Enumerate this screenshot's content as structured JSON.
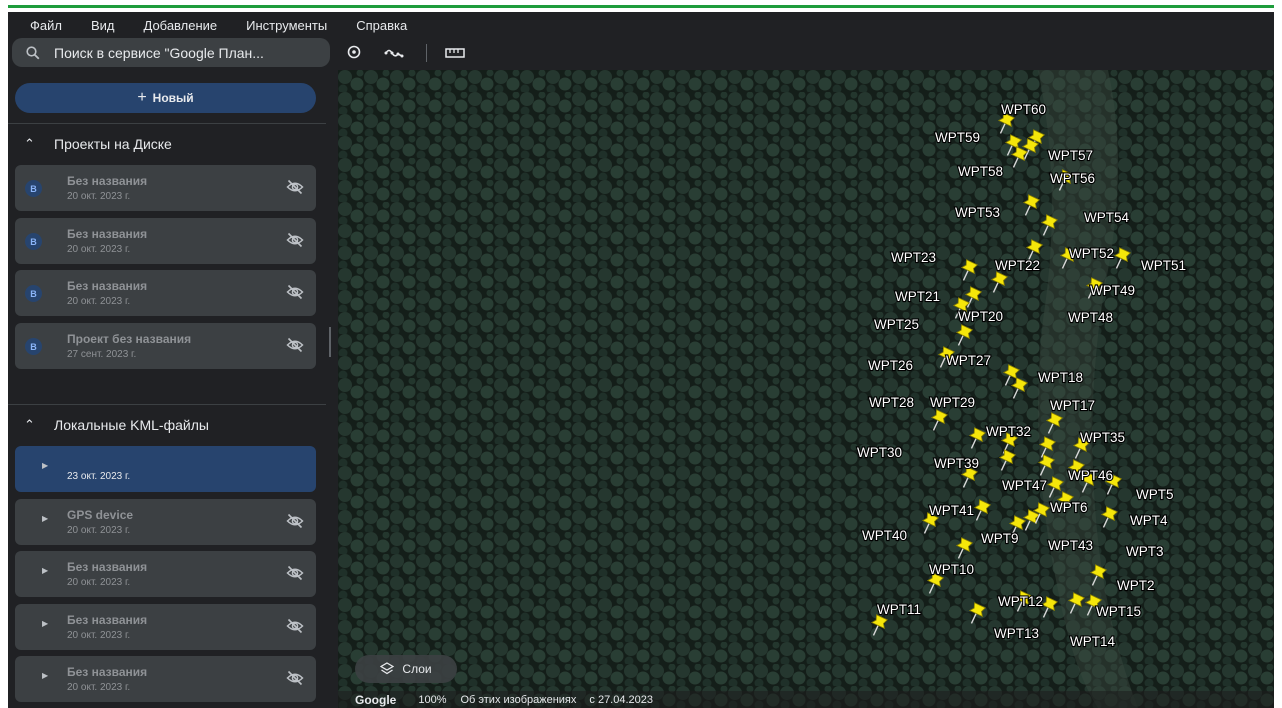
{
  "menu": [
    "Файл",
    "Вид",
    "Добавление",
    "Инструменты",
    "Справка"
  ],
  "search": {
    "placeholder": "Поиск в сервисе \"Google План..."
  },
  "toolbar_icons": [
    "place-pin-icon",
    "path-icon",
    "ruler-icon"
  ],
  "sidebar": {
    "new_button": "Новый",
    "drive_section": {
      "title": "Проекты на Диске",
      "items": [
        {
          "badge": "B",
          "title": "Без названия",
          "date": "20 окт. 2023 г."
        },
        {
          "badge": "B",
          "title": "Без названия",
          "date": "20 окт. 2023 г."
        },
        {
          "badge": "B",
          "title": "Без названия",
          "date": "20 окт. 2023 г."
        },
        {
          "badge": "B",
          "title": "Проект без названия",
          "date": "27 сент. 2023 г."
        }
      ]
    },
    "kml_section": {
      "title": "Локальные KML-файлы",
      "items": [
        {
          "title": "",
          "date": "23 окт. 2023 г.",
          "selected": true
        },
        {
          "title": "GPS device",
          "date": "20 окт. 2023 г."
        },
        {
          "title": "Без названия",
          "date": "20 окт. 2023 г."
        },
        {
          "title": "Без названия",
          "date": "20 окт. 2023 г."
        },
        {
          "title": "Без названия",
          "date": "20 окт. 2023 г."
        }
      ]
    }
  },
  "map": {
    "layers_button": "Слои",
    "footer": {
      "logo": "Google",
      "zoom": "100%",
      "about": "Об этих изображениях",
      "date": "с 27.04.2023"
    },
    "marker_color": "#f5e60a",
    "waypoint_labels": [
      "WPT60",
      "WPT59",
      "WPT57",
      "WPT58",
      "WPT56",
      "WPT53",
      "WPT54",
      "WPT23",
      "WPT22",
      "WPT52",
      "WPT51",
      "WPT21",
      "WPT49",
      "WPT20",
      "WPT48",
      "WPT25",
      "WPT27",
      "WPT26",
      "WPT18",
      "WPT28",
      "WPT29",
      "WPT17",
      "WPT32",
      "WPT35",
      "WPT30",
      "WPT39",
      "WPT46",
      "WPT47",
      "WPT5",
      "WPT41",
      "WPT6",
      "WPT4",
      "WPT40",
      "WPT9",
      "WPT43",
      "WPT3",
      "WPT10",
      "WPT2",
      "WPT12",
      "WPT11",
      "WPT15",
      "WPT13",
      "WPT14"
    ]
  }
}
